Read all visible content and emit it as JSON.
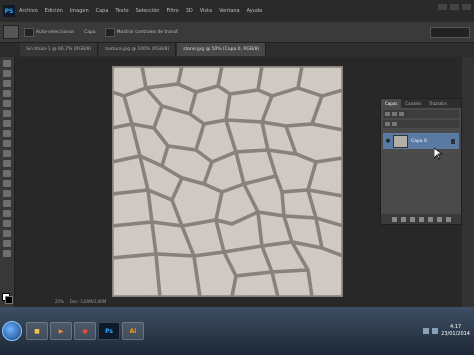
{
  "menubar": {
    "app_icon": "PS",
    "items": [
      "Archivo",
      "Edición",
      "Imagen",
      "Capa",
      "Texto",
      "Selección",
      "Filtro",
      "3D",
      "Vista",
      "Ventana",
      "Ayuda"
    ]
  },
  "options": {
    "opt1": "Auto-seleccionar:",
    "opt2": "Capa",
    "opt3": "Mostrar controles de transf."
  },
  "doc_tabs": [
    "Sin título-1 @ 66,7% (RGB/8)",
    "textura.jpg @ 100% (RGB/8)",
    "stone.jpg @ 50% (Capa 0, RGB/8)"
  ],
  "status": {
    "zoom": "25%",
    "doc": "Doc: 3,00M/3,00M"
  },
  "layers_panel": {
    "tabs": [
      "Capas",
      "Canales",
      "Trazados"
    ],
    "layer_name": "Capa 0"
  },
  "taskbar": {
    "ps_label": "Ps",
    "ai_label": "Ai",
    "time": "4:17",
    "date": "23/01/2014"
  },
  "colors": {
    "ps_accent": "#31a8ff",
    "selected_layer": "#5a7aa3",
    "taskbar": "#1d2836"
  },
  "icons": {
    "tools": [
      "move-tool",
      "marquee-tool",
      "lasso-tool",
      "quick-select-tool",
      "crop-tool",
      "eyedropper-tool",
      "healing-tool",
      "brush-tool",
      "stamp-tool",
      "history-brush-tool",
      "eraser-tool",
      "gradient-tool",
      "blur-tool",
      "dodge-tool",
      "pen-tool",
      "type-tool",
      "path-select-tool",
      "shape-tool",
      "hand-tool",
      "zoom-tool"
    ]
  }
}
